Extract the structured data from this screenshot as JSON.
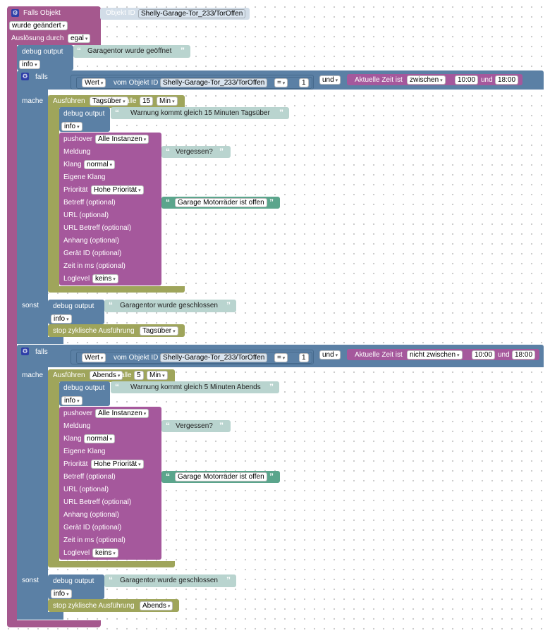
{
  "trigger": {
    "title": "Falls Objekt",
    "object_label": "Objekt ID",
    "object_id": "Shelly-Garage-Tor_233/TorOffen",
    "changed": "wurde geändert",
    "ausloesung_label": "Auslösung durch",
    "ausloesung_value": "egal"
  },
  "debug_top": {
    "label": "debug output",
    "text": "Garagentor wurde geöffnet",
    "level": "info"
  },
  "common": {
    "falls": "falls",
    "mache": "mache",
    "sonst": "sonst",
    "und": "und",
    "wert": "Wert",
    "vom_objekt": "vom Objekt ID",
    "object_id": "Shelly-Garage-Tor_233/TorOffen",
    "eq": "=",
    "one": "1",
    "zeit_label": "Aktuelle Zeit ist",
    "und_small": "und",
    "ausfuehren": "Ausführen",
    "alle": "alle",
    "debug_output": "debug output",
    "info": "info",
    "pushover": "pushover",
    "instanzen": "Alle Instanzen",
    "meldung": "Meldung",
    "vergessen": "Vergessen?",
    "klang": "Klang",
    "klang_value": "normal",
    "eigene_klang": "Eigene Klang",
    "prioritaet": "Priorität",
    "prioritaet_value": "Hohe Priorität",
    "betreff": "Betreff (optional)",
    "betreff_value": "Garage Motorräder ist offen",
    "url": "URL (optional)",
    "url_betreff": "URL Betreff (optional)",
    "anhang": "Anhang (optional)",
    "geraet": "Gerät ID (optional)",
    "zeit_ms": "Zeit in ms (optional)",
    "loglevel": "Loglevel",
    "loglevel_value": "keins",
    "geschlossen": "Garagentor wurde geschlossen",
    "stop": "stop zyklische Ausführung"
  },
  "block1": {
    "zeit_op": "zwischen",
    "t1": "10:00",
    "t2": "18:00",
    "schedule_name": "Tagsüber",
    "interval": "15",
    "unit": "Min",
    "warn": "Warnung kommt gleich 15 Minuten Tagsüber",
    "stop_name": "Tagsüber"
  },
  "block2": {
    "zeit_op": "nicht zwischen",
    "t1": "10:00",
    "t2": "18:00",
    "schedule_name": "Abends",
    "interval": "5",
    "unit": "Min",
    "warn": "Warnung kommt gleich 5 Minuten Abends",
    "stop_name": "Abends"
  },
  "colors": {
    "trigger": "#a5588e",
    "logic": "#5b80a5",
    "timer": "#9fa55b",
    "pushover": "#a5589c",
    "string": "#b9d4cf",
    "string_green": "#5ba58c"
  }
}
